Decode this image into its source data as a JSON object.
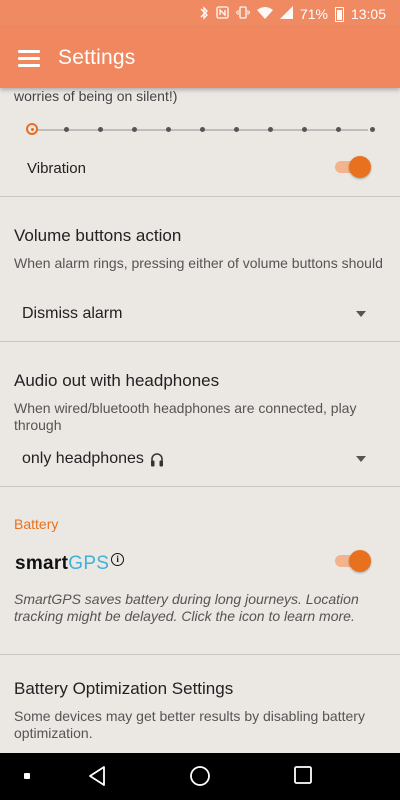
{
  "status_bar": {
    "battery_percent": "71%",
    "time": "13:05",
    "icons": [
      "bluetooth-icon",
      "nfc-icon",
      "vibrate-icon",
      "wifi-icon",
      "signal-icon",
      "battery-icon"
    ]
  },
  "app_bar": {
    "title": "Settings",
    "menu_icon": "hamburger-icon"
  },
  "alarm_volume": {
    "truncated_text": "worries of being on silent!)",
    "slider_steps": 11,
    "slider_value_step": 0
  },
  "vibration": {
    "label": "Vibration",
    "enabled": true
  },
  "volume_buttons": {
    "title": "Volume buttons action",
    "description": "When alarm rings, pressing either of volume buttons should",
    "selected": "Dismiss alarm"
  },
  "audio_out": {
    "title": "Audio out with headphones",
    "description": "When wired/bluetooth headphones are connected, play through",
    "selected": "only headphones",
    "selected_icon": "headphones-icon"
  },
  "battery": {
    "category": "Battery",
    "smartgps_logo_part1": "smart",
    "smartgps_logo_part2": "GPS",
    "smartgps_enabled": true,
    "smartgps_description": "SmartGPS saves battery during long journeys. Location tracking might be delayed. Click the icon to learn more."
  },
  "battery_optimization": {
    "title": "Battery Optimization Settings",
    "description": "Some devices may get better results by disabling battery optimization."
  },
  "colors": {
    "accent": "#e8711f",
    "app_bar": "#f0875f",
    "background": "#ebe7e3",
    "gps_blue": "#3fb2d8"
  }
}
